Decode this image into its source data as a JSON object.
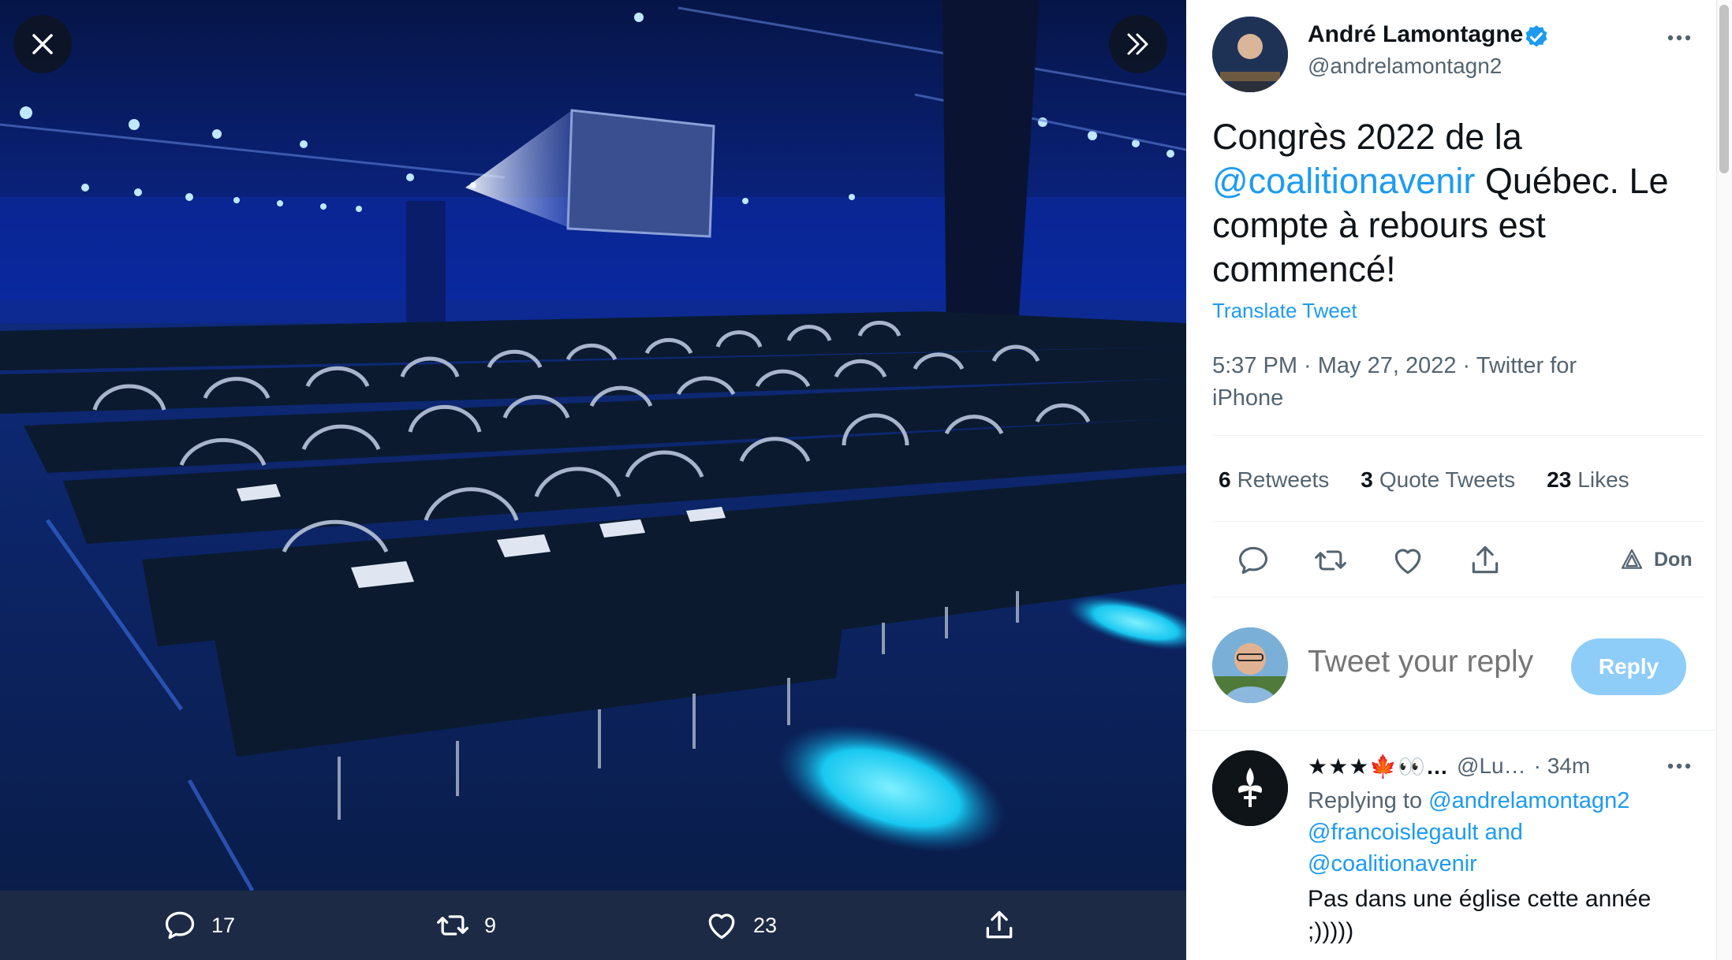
{
  "colors": {
    "accent": "#1d9bf0",
    "text_primary": "#0f1419",
    "text_secondary": "#536471",
    "reply_button_disabled": "#8ecdf7",
    "media_bar": "#1c2a45"
  },
  "media_viewer": {
    "close_icon": "close-icon",
    "expand_icon": "chevron-double-right-icon",
    "actions": {
      "reply_count": "17",
      "retweet_count": "9",
      "like_count": "23"
    }
  },
  "tweet": {
    "author": {
      "name": "André Lamontagne",
      "handle": "@andrelamontagn2",
      "verified": true
    },
    "text": {
      "part1": "Congrès 2022 de la",
      "mention": "@coalitionavenir",
      "part2": " Québec. Le compte à rebours est commencé!"
    },
    "translate_label": "Translate Tweet",
    "timestamp": "5:37 PM · May 27, 2022 · Twitter for iPhone",
    "stats": {
      "retweets_count": "6",
      "retweets_label": "Retweets",
      "quotes_count": "3",
      "quotes_label": "Quote Tweets",
      "likes_count": "23",
      "likes_label": "Likes"
    },
    "donate_label": "Don"
  },
  "reply_composer": {
    "placeholder": "Tweet your reply",
    "button_label": "Reply"
  },
  "reply": {
    "name": "★★★🍁👀…",
    "handle": "@Lu…",
    "time": "· 34m",
    "replying_label": "Replying to",
    "mention1": "@andrelamontagn2",
    "mention2": "@francoislegault",
    "and_label": "and",
    "mention3": "@coalitionavenir",
    "text": "Pas dans une église cette année ;)))))"
  }
}
